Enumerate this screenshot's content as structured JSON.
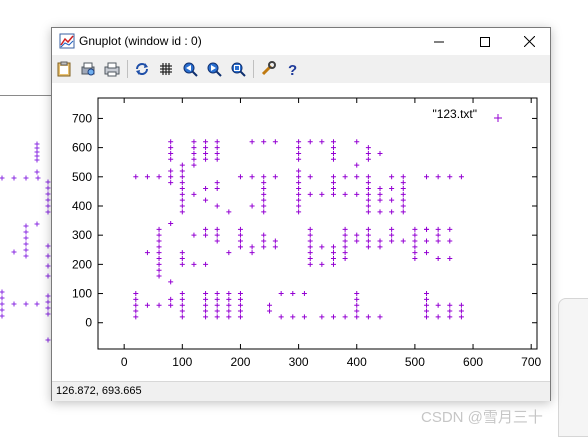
{
  "window": {
    "title": "Gnuplot (window id : 0)"
  },
  "controls": {
    "minimize": "—",
    "maximize": "☐",
    "close": "✕"
  },
  "toolbar": {
    "items": [
      "clipboard-icon",
      "print-preview-icon",
      "printer-icon",
      "replot-icon",
      "grid-icon",
      "zoom-previous-icon",
      "zoom-next-icon",
      "unzoom-icon",
      "options-icon",
      "help-icon"
    ]
  },
  "status": {
    "coords": "126.872,  693.665"
  },
  "watermark": "CSDN @雪月三十",
  "colors": {
    "points": "#9400d3",
    "bg_points": "#8a2be2"
  },
  "chart_data": {
    "type": "scatter",
    "title": "",
    "xlabel": "",
    "ylabel": "",
    "xlim": [
      -45,
      710
    ],
    "ylim": [
      -90,
      770
    ],
    "xticks": [
      0,
      100,
      200,
      300,
      400,
      500,
      600,
      700
    ],
    "yticks": [
      0,
      100,
      200,
      300,
      400,
      500,
      600,
      700
    ],
    "series": [
      {
        "name": "\"123.txt\"",
        "marker": "+",
        "points": [
          [
            20,
            100
          ],
          [
            20,
            80
          ],
          [
            20,
            60
          ],
          [
            20,
            40
          ],
          [
            20,
            20
          ],
          [
            40,
            60
          ],
          [
            60,
            60
          ],
          [
            80,
            80
          ],
          [
            80,
            60
          ],
          [
            100,
            100
          ],
          [
            100,
            80
          ],
          [
            100,
            60
          ],
          [
            100,
            40
          ],
          [
            100,
            20
          ],
          [
            140,
            100
          ],
          [
            140,
            80
          ],
          [
            140,
            60
          ],
          [
            140,
            40
          ],
          [
            140,
            20
          ],
          [
            160,
            100
          ],
          [
            160,
            80
          ],
          [
            160,
            60
          ],
          [
            160,
            40
          ],
          [
            160,
            20
          ],
          [
            180,
            100
          ],
          [
            180,
            80
          ],
          [
            180,
            60
          ],
          [
            180,
            40
          ],
          [
            180,
            20
          ],
          [
            200,
            100
          ],
          [
            200,
            80
          ],
          [
            200,
            60
          ],
          [
            200,
            40
          ],
          [
            200,
            20
          ],
          [
            250,
            60
          ],
          [
            250,
            40
          ],
          [
            270,
            100
          ],
          [
            270,
            20
          ],
          [
            290,
            100
          ],
          [
            290,
            20
          ],
          [
            310,
            100
          ],
          [
            310,
            20
          ],
          [
            340,
            20
          ],
          [
            360,
            20
          ],
          [
            380,
            20
          ],
          [
            400,
            100
          ],
          [
            400,
            80
          ],
          [
            400,
            60
          ],
          [
            400,
            40
          ],
          [
            400,
            20
          ],
          [
            420,
            20
          ],
          [
            440,
            20
          ],
          [
            520,
            100
          ],
          [
            520,
            80
          ],
          [
            520,
            60
          ],
          [
            520,
            40
          ],
          [
            520,
            20
          ],
          [
            540,
            60
          ],
          [
            540,
            20
          ],
          [
            560,
            60
          ],
          [
            560,
            40
          ],
          [
            560,
            20
          ],
          [
            580,
            60
          ],
          [
            580,
            40
          ],
          [
            580,
            20
          ],
          [
            40,
            240
          ],
          [
            60,
            320
          ],
          [
            60,
            300
          ],
          [
            60,
            280
          ],
          [
            60,
            260
          ],
          [
            60,
            240
          ],
          [
            60,
            220
          ],
          [
            60,
            200
          ],
          [
            60,
            180
          ],
          [
            60,
            160
          ],
          [
            80,
            340
          ],
          [
            80,
            140
          ],
          [
            100,
            240
          ],
          [
            100,
            220
          ],
          [
            100,
            200
          ],
          [
            120,
            300
          ],
          [
            120,
            200
          ],
          [
            140,
            320
          ],
          [
            140,
            300
          ],
          [
            140,
            200
          ],
          [
            160,
            320
          ],
          [
            160,
            300
          ],
          [
            160,
            280
          ],
          [
            180,
            240
          ],
          [
            200,
            320
          ],
          [
            200,
            300
          ],
          [
            200,
            280
          ],
          [
            200,
            260
          ],
          [
            220,
            260
          ],
          [
            220,
            240
          ],
          [
            240,
            300
          ],
          [
            240,
            280
          ],
          [
            240,
            260
          ],
          [
            260,
            280
          ],
          [
            260,
            260
          ],
          [
            320,
            320
          ],
          [
            320,
            300
          ],
          [
            320,
            280
          ],
          [
            320,
            260
          ],
          [
            320,
            240
          ],
          [
            320,
            220
          ],
          [
            320,
            200
          ],
          [
            340,
            260
          ],
          [
            340,
            200
          ],
          [
            360,
            260
          ],
          [
            360,
            240
          ],
          [
            360,
            220
          ],
          [
            360,
            200
          ],
          [
            380,
            320
          ],
          [
            380,
            300
          ],
          [
            380,
            280
          ],
          [
            380,
            260
          ],
          [
            380,
            240
          ],
          [
            380,
            220
          ],
          [
            400,
            300
          ],
          [
            400,
            280
          ],
          [
            420,
            320
          ],
          [
            420,
            300
          ],
          [
            420,
            280
          ],
          [
            420,
            260
          ],
          [
            440,
            280
          ],
          [
            440,
            260
          ],
          [
            460,
            320
          ],
          [
            460,
            300
          ],
          [
            460,
            280
          ],
          [
            480,
            280
          ],
          [
            500,
            320
          ],
          [
            500,
            300
          ],
          [
            500,
            280
          ],
          [
            500,
            260
          ],
          [
            500,
            240
          ],
          [
            500,
            220
          ],
          [
            520,
            320
          ],
          [
            520,
            280
          ],
          [
            520,
            240
          ],
          [
            540,
            320
          ],
          [
            540,
            280
          ],
          [
            540,
            220
          ],
          [
            560,
            320
          ],
          [
            560,
            280
          ],
          [
            560,
            220
          ],
          [
            20,
            500
          ],
          [
            40,
            500
          ],
          [
            60,
            500
          ],
          [
            80,
            520
          ],
          [
            80,
            500
          ],
          [
            80,
            480
          ],
          [
            100,
            540
          ],
          [
            100,
            520
          ],
          [
            100,
            500
          ],
          [
            100,
            480
          ],
          [
            100,
            460
          ],
          [
            100,
            440
          ],
          [
            100,
            420
          ],
          [
            100,
            400
          ],
          [
            100,
            380
          ],
          [
            120,
            440
          ],
          [
            140,
            460
          ],
          [
            140,
            420
          ],
          [
            160,
            480
          ],
          [
            160,
            460
          ],
          [
            160,
            400
          ],
          [
            180,
            380
          ],
          [
            200,
            500
          ],
          [
            220,
            500
          ],
          [
            220,
            400
          ],
          [
            240,
            500
          ],
          [
            240,
            480
          ],
          [
            240,
            460
          ],
          [
            240,
            440
          ],
          [
            240,
            420
          ],
          [
            240,
            400
          ],
          [
            240,
            380
          ],
          [
            260,
            500
          ],
          [
            300,
            520
          ],
          [
            300,
            500
          ],
          [
            300,
            480
          ],
          [
            300,
            460
          ],
          [
            300,
            440
          ],
          [
            300,
            420
          ],
          [
            300,
            400
          ],
          [
            300,
            380
          ],
          [
            320,
            500
          ],
          [
            320,
            440
          ],
          [
            340,
            440
          ],
          [
            360,
            500
          ],
          [
            360,
            480
          ],
          [
            360,
            460
          ],
          [
            360,
            440
          ],
          [
            380,
            500
          ],
          [
            380,
            440
          ],
          [
            400,
            540
          ],
          [
            400,
            500
          ],
          [
            400,
            440
          ],
          [
            420,
            500
          ],
          [
            420,
            480
          ],
          [
            420,
            460
          ],
          [
            420,
            440
          ],
          [
            420,
            420
          ],
          [
            420,
            400
          ],
          [
            420,
            380
          ],
          [
            440,
            460
          ],
          [
            440,
            440
          ],
          [
            440,
            420
          ],
          [
            440,
            380
          ],
          [
            460,
            500
          ],
          [
            460,
            460
          ],
          [
            460,
            420
          ],
          [
            460,
            380
          ],
          [
            480,
            500
          ],
          [
            480,
            480
          ],
          [
            480,
            460
          ],
          [
            480,
            440
          ],
          [
            480,
            420
          ],
          [
            480,
            400
          ],
          [
            480,
            380
          ],
          [
            80,
            620
          ],
          [
            80,
            600
          ],
          [
            80,
            580
          ],
          [
            80,
            560
          ],
          [
            120,
            620
          ],
          [
            120,
            600
          ],
          [
            120,
            580
          ],
          [
            120,
            560
          ],
          [
            120,
            540
          ],
          [
            140,
            620
          ],
          [
            140,
            600
          ],
          [
            140,
            580
          ],
          [
            140,
            560
          ],
          [
            160,
            620
          ],
          [
            160,
            600
          ],
          [
            160,
            580
          ],
          [
            160,
            560
          ],
          [
            220,
            620
          ],
          [
            240,
            620
          ],
          [
            260,
            620
          ],
          [
            300,
            620
          ],
          [
            300,
            600
          ],
          [
            300,
            580
          ],
          [
            300,
            560
          ],
          [
            320,
            620
          ],
          [
            340,
            620
          ],
          [
            360,
            620
          ],
          [
            360,
            600
          ],
          [
            360,
            580
          ],
          [
            360,
            560
          ],
          [
            400,
            620
          ],
          [
            420,
            600
          ],
          [
            420,
            580
          ],
          [
            420,
            560
          ],
          [
            440,
            580
          ],
          [
            520,
            500
          ],
          [
            540,
            500
          ],
          [
            560,
            500
          ],
          [
            580,
            500
          ],
          [
            520,
            320
          ],
          [
            540,
            300
          ]
        ]
      }
    ]
  }
}
